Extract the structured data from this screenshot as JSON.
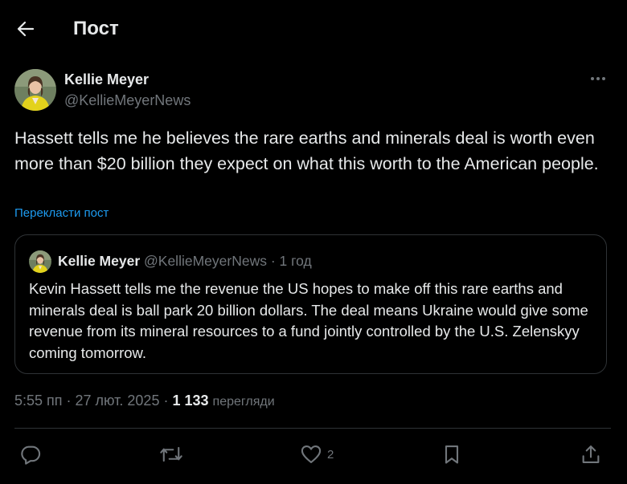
{
  "header": {
    "title": "Пост",
    "back_icon": "arrow-left-icon"
  },
  "author": {
    "name": "Kellie Meyer",
    "handle": "@KellieMeyerNews",
    "more_icon": "more-horizontal-icon"
  },
  "tweet": {
    "text": "Hassett tells me he believes the rare earths and minerals deal is worth even more than $20 billion they expect on what this worth to the American people.",
    "translate_label": "Перекласти пост"
  },
  "quote": {
    "name": "Kellie Meyer",
    "handle": "@KellieMeyerNews",
    "separator": " · ",
    "time": "1 год",
    "text": "Kevin Hassett tells me the revenue the US hopes to make off this rare earths and minerals deal is ball park 20 billion dollars. The deal means Ukraine would give some revenue from its mineral resources to a fund jointly controlled by the U.S. Zelenskyy coming tomorrow."
  },
  "meta": {
    "time": "5:55 пп",
    "separator": " · ",
    "date": "27 лют. 2025",
    "views_count": "1 133",
    "views_label": "перегляди"
  },
  "actions": {
    "reply_icon": "reply-icon",
    "repost_icon": "repost-icon",
    "like_icon": "heart-icon",
    "like_count": "2",
    "bookmark_icon": "bookmark-icon",
    "share_icon": "share-icon"
  },
  "colors": {
    "background": "#000000",
    "text": "#e7e9ea",
    "muted": "#71767b",
    "link": "#1d9bf0",
    "border": "#2f3336"
  }
}
